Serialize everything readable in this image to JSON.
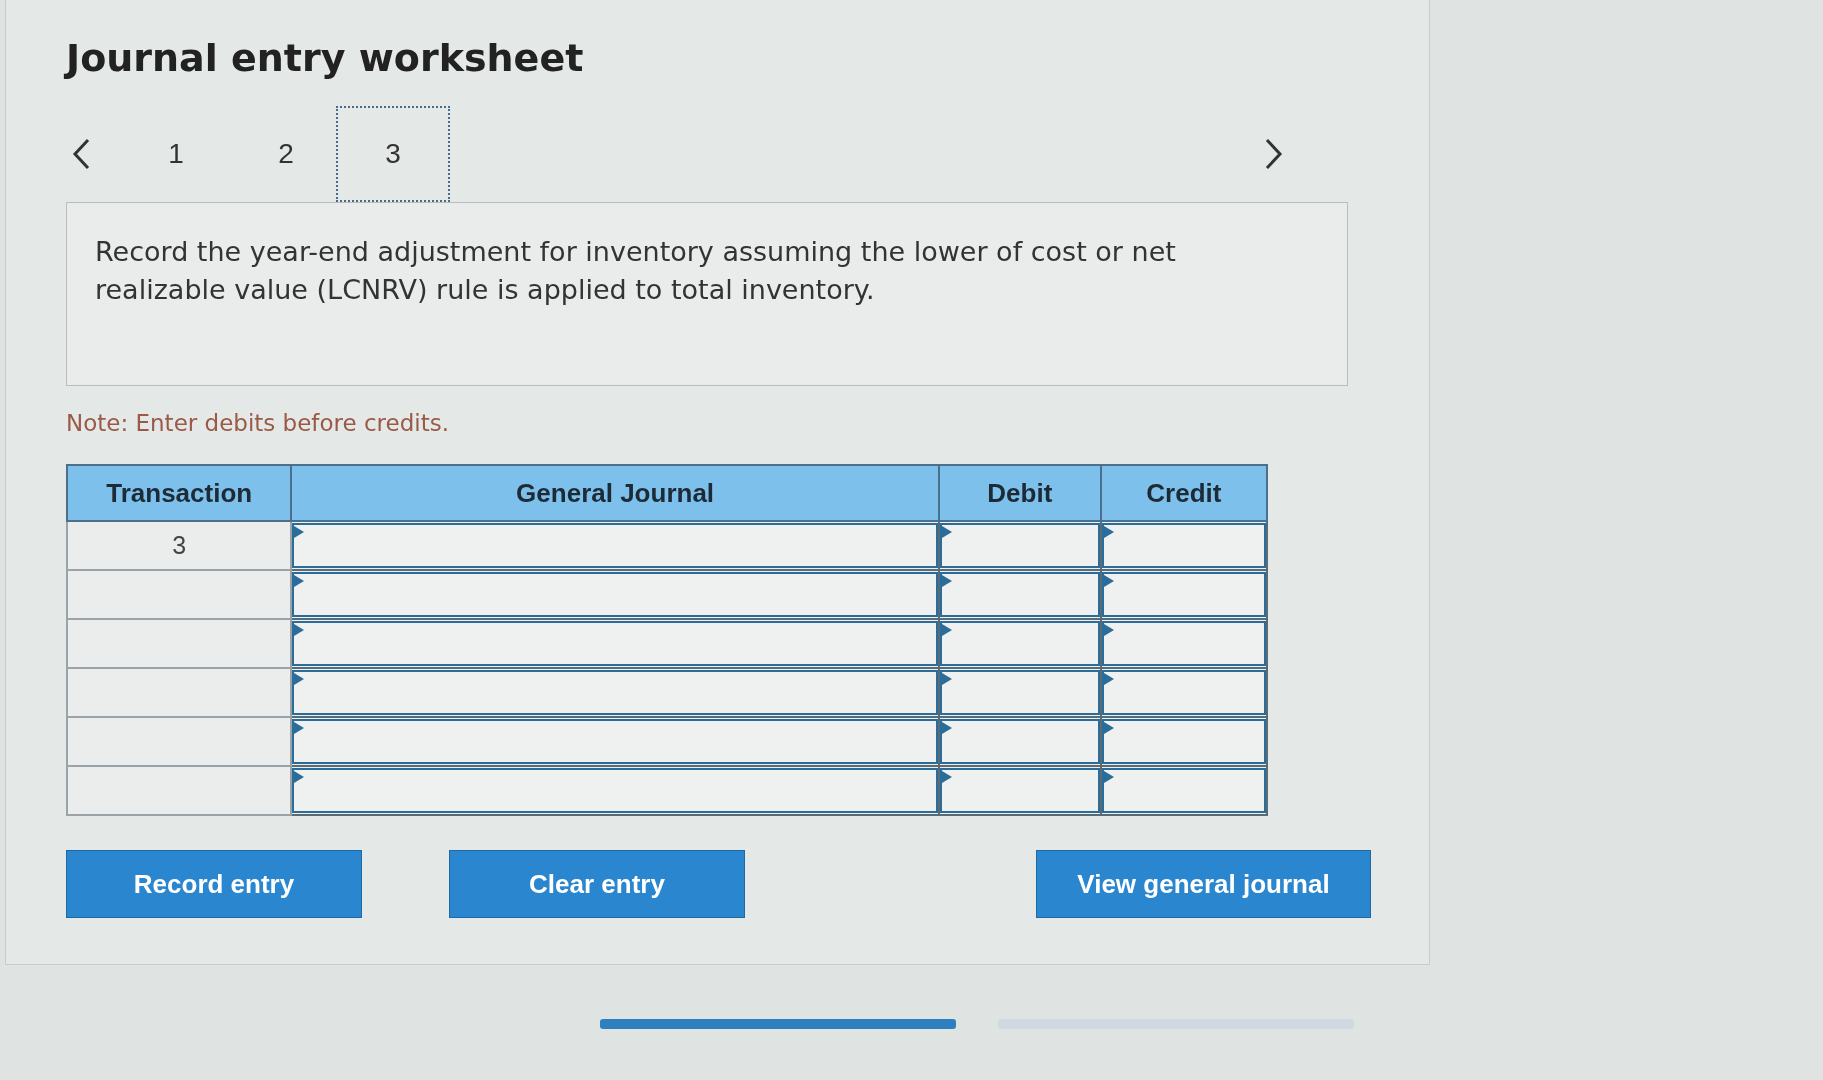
{
  "title": "Journal entry worksheet",
  "steps": [
    {
      "label": "1",
      "selected": false
    },
    {
      "label": "2",
      "selected": false
    },
    {
      "label": "3",
      "selected": true
    }
  ],
  "question": "Record the year-end adjustment for inventory assuming the lower of cost or net realizable value (LCNRV) rule is applied to total inventory.",
  "note": "Note: Enter debits before credits.",
  "table": {
    "columns": [
      "Transaction",
      "General Journal",
      "Debit",
      "Credit"
    ],
    "rows": [
      {
        "transaction": "3"
      },
      {
        "transaction": ""
      },
      {
        "transaction": ""
      },
      {
        "transaction": ""
      },
      {
        "transaction": ""
      },
      {
        "transaction": ""
      }
    ]
  },
  "buttons": [
    "Record entry",
    "Clear entry",
    "View general journal"
  ],
  "pager": [
    {
      "selected": true
    },
    {
      "selected": false
    }
  ]
}
